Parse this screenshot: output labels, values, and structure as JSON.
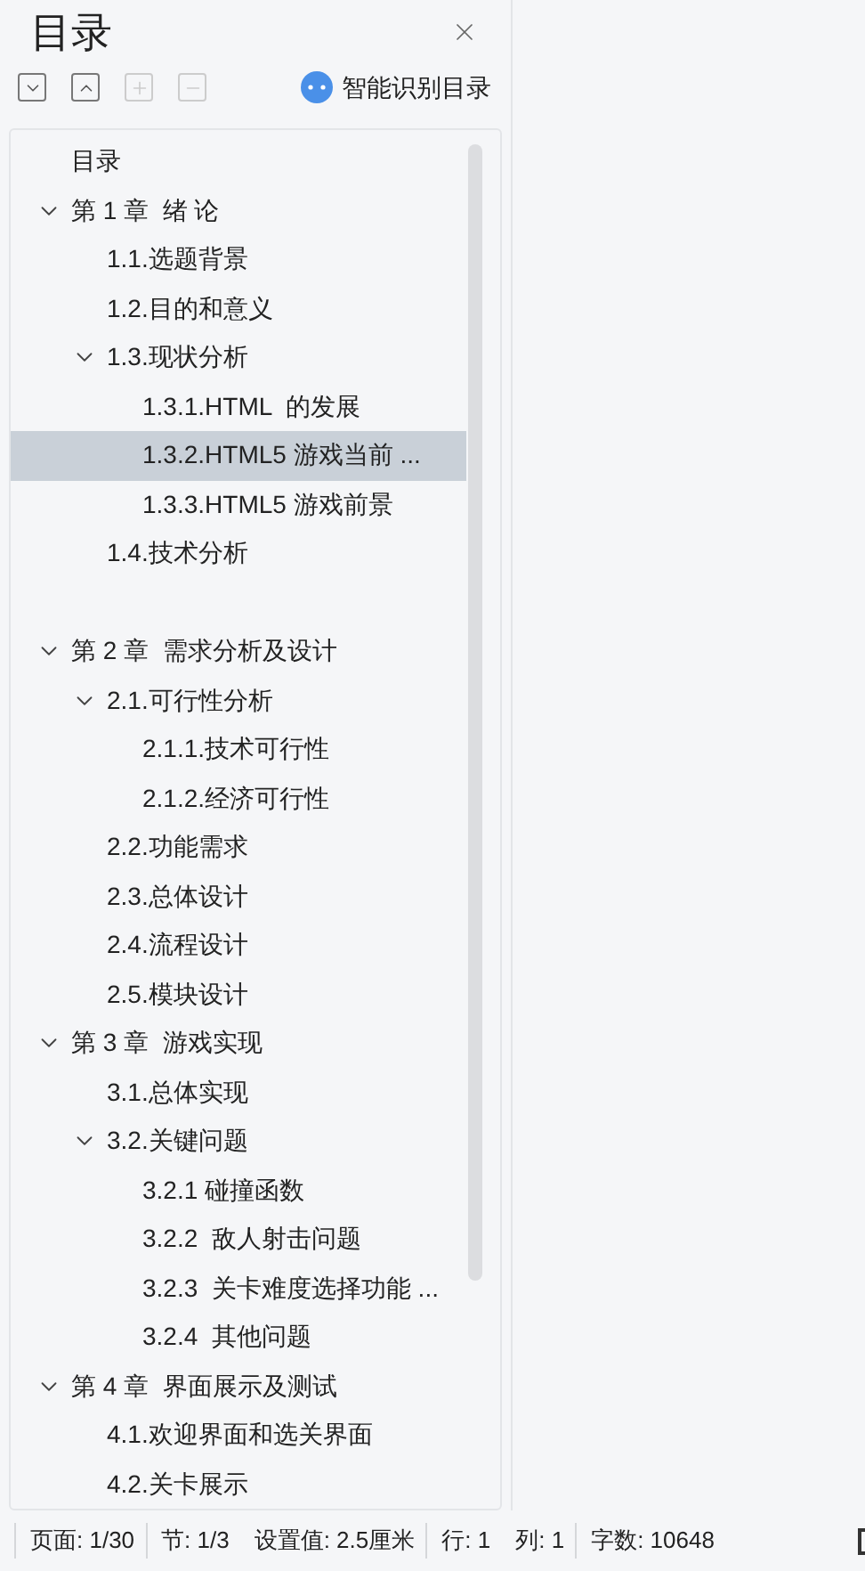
{
  "panel": {
    "title": "目录",
    "toolbar": [
      {
        "kind": "expand_all",
        "disabled": false
      },
      {
        "kind": "collapse_all",
        "disabled": false
      },
      {
        "kind": "add",
        "disabled": true
      },
      {
        "kind": "remove",
        "disabled": true
      }
    ],
    "smart_button": "智能识别目录"
  },
  "toc": [
    {
      "label": "目录",
      "selected": false
    },
    {
      "label": "第 1 章  绪 论",
      "selected": false,
      "expanded": true,
      "children": [
        {
          "label": "1.1.选题背景",
          "selected": false
        },
        {
          "label": "1.2.目的和意义",
          "selected": false
        },
        {
          "label": "1.3.现状分析",
          "selected": false,
          "expanded": true,
          "children": [
            {
              "label": "1.3.1.HTML  的发展",
              "selected": false
            },
            {
              "label": "1.3.2.HTML5 游戏当前 ...",
              "selected": true
            },
            {
              "label": "1.3.3.HTML5 游戏前景",
              "selected": false
            }
          ]
        },
        {
          "label": "1.4.技术分析",
          "selected": false
        }
      ]
    },
    {
      "label": "第 2 章  需求分析及设计",
      "selected": false,
      "expanded": true,
      "gap_before": true,
      "children": [
        {
          "label": "2.1.可行性分析",
          "selected": false,
          "expanded": true,
          "children": [
            {
              "label": "2.1.1.技术可行性",
              "selected": false
            },
            {
              "label": "2.1.2.经济可行性",
              "selected": false
            }
          ]
        },
        {
          "label": "2.2.功能需求",
          "selected": false
        },
        {
          "label": "2.3.总体设计",
          "selected": false
        },
        {
          "label": "2.4.流程设计",
          "selected": false
        },
        {
          "label": "2.5.模块设计",
          "selected": false
        }
      ]
    },
    {
      "label": "第 3 章  游戏实现",
      "selected": false,
      "expanded": true,
      "children": [
        {
          "label": "3.1.总体实现",
          "selected": false
        },
        {
          "label": "3.2.关键问题",
          "selected": false,
          "expanded": true,
          "children": [
            {
              "label": "3.2.1 碰撞函数",
              "selected": false
            },
            {
              "label": "3.2.2  敌人射击问题",
              "selected": false
            },
            {
              "label": "3.2.3  关卡难度选择功能 ...",
              "selected": false
            },
            {
              "label": "3.2.4  其他问题",
              "selected": false
            }
          ]
        }
      ]
    },
    {
      "label": "第 4 章  界面展示及测试",
      "selected": false,
      "expanded": true,
      "children": [
        {
          "label": "4.1.欢迎界面和选关界面",
          "selected": false
        },
        {
          "label": "4.2.关卡展示",
          "selected": false
        }
      ]
    }
  ],
  "status_bar": [
    [
      "页面: 1/30"
    ],
    [
      "节: 1/3",
      "设置值: 2.5厘米"
    ],
    [
      "行: 1",
      "列: 1"
    ],
    [
      "字数: 10648"
    ]
  ]
}
